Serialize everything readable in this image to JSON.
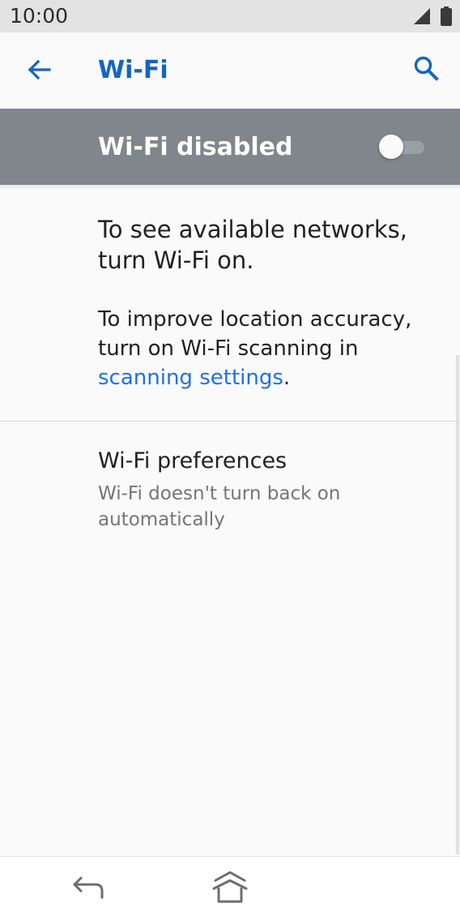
{
  "status_bar": {
    "time": "10:00",
    "icons": [
      "signal-icon",
      "battery-icon"
    ]
  },
  "app_bar": {
    "title": "Wi-Fi",
    "back_icon": "arrow-back-icon",
    "search_icon": "search-icon",
    "accent_color": "#1565c0"
  },
  "master_switch": {
    "label": "Wi-Fi disabled",
    "enabled": false,
    "background_color": "#80868b"
  },
  "info": {
    "main": "To see available networks, turn Wi-Fi on.",
    "secondary_prefix": "To improve location accuracy, turn on Wi-Fi scanning in",
    "secondary_link": "scanning settings",
    "secondary_suffix": ".",
    "link_color": "#1a73e8"
  },
  "preferences": {
    "title": "Wi-Fi preferences",
    "summary": "Wi-Fi doesn't turn back on automatically"
  },
  "nav_bar": {
    "icons": [
      "back-nav-icon",
      "home-nav-icon"
    ]
  }
}
